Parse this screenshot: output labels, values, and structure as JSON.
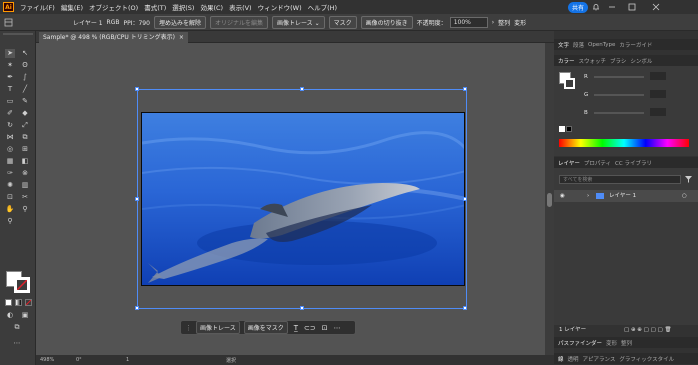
{
  "menubar": {
    "app_logo": "Ai",
    "items": [
      "ファイル(F)",
      "編集(E)",
      "オブジェクト(O)",
      "書式(T)",
      "選択(S)",
      "効果(C)",
      "表示(V)",
      "ウィンドウ(W)",
      "ヘルプ(H)"
    ],
    "share": "共有"
  },
  "control_bar": {
    "layer": "レイヤー 1",
    "rgb": "RGB",
    "ppi": "PPI：790",
    "unembed": "埋め込みを解除",
    "edit_original": "オリジナルを編集",
    "image_trace": "画像トレース",
    "mask": "マスク",
    "crop": "画像の切り抜き",
    "opacity_label": "不透明度：",
    "opacity_value": "100%",
    "align": "整列",
    "transform": "変形"
  },
  "document": {
    "tab_title": "Sample* @ 498 % (RGB/CPU トリミング表示)",
    "close": "×"
  },
  "context_bar": {
    "trace": "画像トレース",
    "mask": "画像をマスク"
  },
  "status": {
    "zoom": "498%",
    "angle": "0°",
    "page": "1",
    "label": "選択"
  },
  "panels": {
    "top_tabs": [
      "文字",
      "段落",
      "OpenType",
      "カラーガイド"
    ],
    "color_tabs": [
      "カラー",
      "スウォッチ",
      "ブラシ",
      "シンボル"
    ],
    "color_labels": [
      "R",
      "G",
      "B"
    ],
    "layers_tabs": [
      "レイヤー",
      "プロパティ",
      "CC ライブラリ"
    ],
    "layers_search": "すべてを検索",
    "layer_name": "レイヤー 1",
    "layer_count": "1 レイヤー",
    "bottom_tabs": [
      "パスファインダー",
      "変形",
      "整列"
    ],
    "bottom_tabs2": [
      "線",
      "透明",
      "アピアランス",
      "グラフィックスタイル"
    ]
  },
  "colors": {
    "accent": "#1473e6",
    "selection": "#4f8cf7",
    "ai_orange": "#ff9a00"
  }
}
